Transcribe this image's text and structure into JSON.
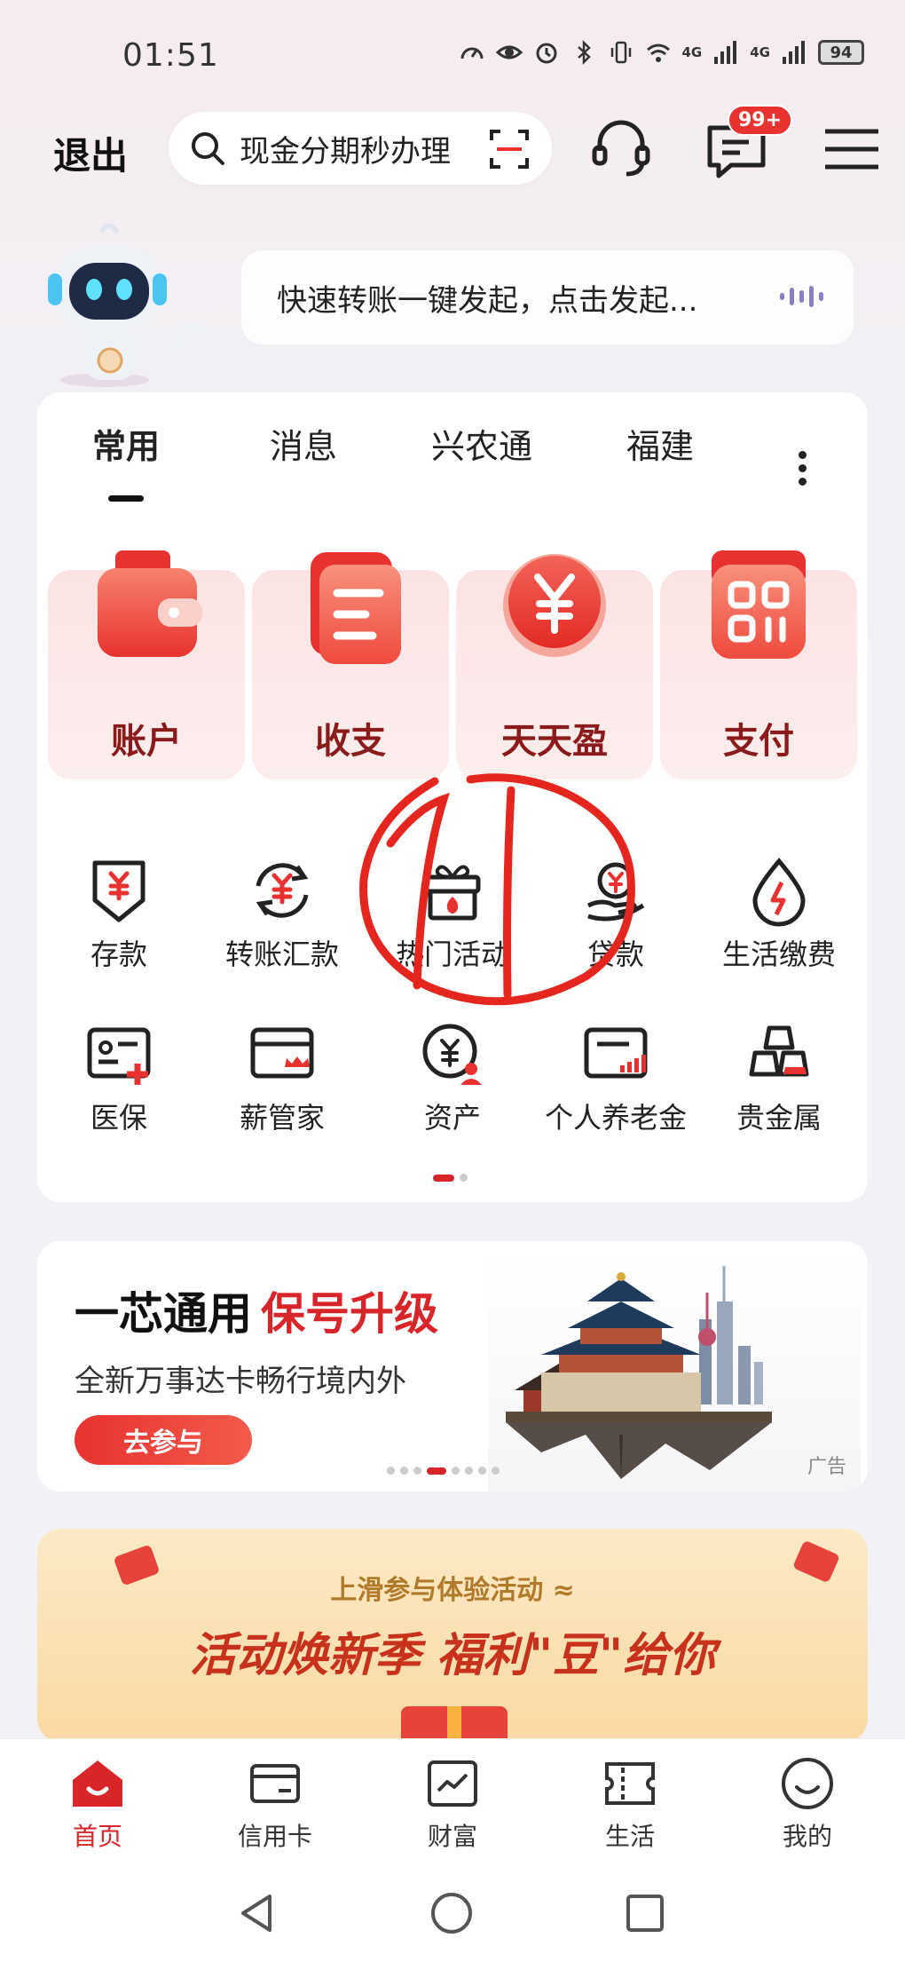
{
  "status_bar": {
    "time": "01:51",
    "net1": "4G",
    "net2": "4G",
    "battery": "94"
  },
  "header": {
    "exit_label": "退出",
    "search_placeholder": "现金分期秒办理",
    "message_badge": "99+"
  },
  "assistant": {
    "bubble_text": "快速转账一键发起，点击发起..."
  },
  "tabs": [
    "常用",
    "消息",
    "兴农通",
    "福建"
  ],
  "big_tiles": [
    {
      "label": "账户",
      "icon": "wallet-icon"
    },
    {
      "label": "收支",
      "icon": "ledger-icon"
    },
    {
      "label": "天天盈",
      "icon": "yuan-coin-icon"
    },
    {
      "label": "支付",
      "icon": "qr-pay-icon"
    }
  ],
  "grid_items": [
    {
      "label": "存款",
      "icon": "deposit-icon"
    },
    {
      "label": "转账汇款",
      "icon": "transfer-icon"
    },
    {
      "label": "热门活动",
      "icon": "gift-icon"
    },
    {
      "label": "贷款",
      "icon": "loan-icon"
    },
    {
      "label": "生活缴费",
      "icon": "utility-drop-icon"
    },
    {
      "label": "医保",
      "icon": "medical-card-icon"
    },
    {
      "label": "薪管家",
      "icon": "salary-card-icon"
    },
    {
      "label": "资产",
      "icon": "asset-icon"
    },
    {
      "label": "个人养老金",
      "icon": "pension-card-icon"
    },
    {
      "label": "贵金属",
      "icon": "gold-bars-icon"
    }
  ],
  "ad": {
    "title_black": "一芯通用",
    "title_red": "保号升级",
    "subtitle": "全新万事达卡畅行境内外",
    "button": "去参与",
    "tag": "广告"
  },
  "promo": {
    "top_text": "上滑参与体验活动 ≈",
    "main_text": "活动焕新季  福利\"豆\"给你"
  },
  "bottom_nav": [
    {
      "label": "首页",
      "icon": "home-icon",
      "active": true
    },
    {
      "label": "信用卡",
      "icon": "credit-card-icon",
      "active": false
    },
    {
      "label": "财富",
      "icon": "wealth-chart-icon",
      "active": false
    },
    {
      "label": "生活",
      "icon": "ticket-icon",
      "active": false
    },
    {
      "label": "我的",
      "icon": "smile-face-icon",
      "active": false
    }
  ],
  "colors": {
    "brand_red": "#d7252a",
    "tile_bg": "#fbe3e3"
  }
}
